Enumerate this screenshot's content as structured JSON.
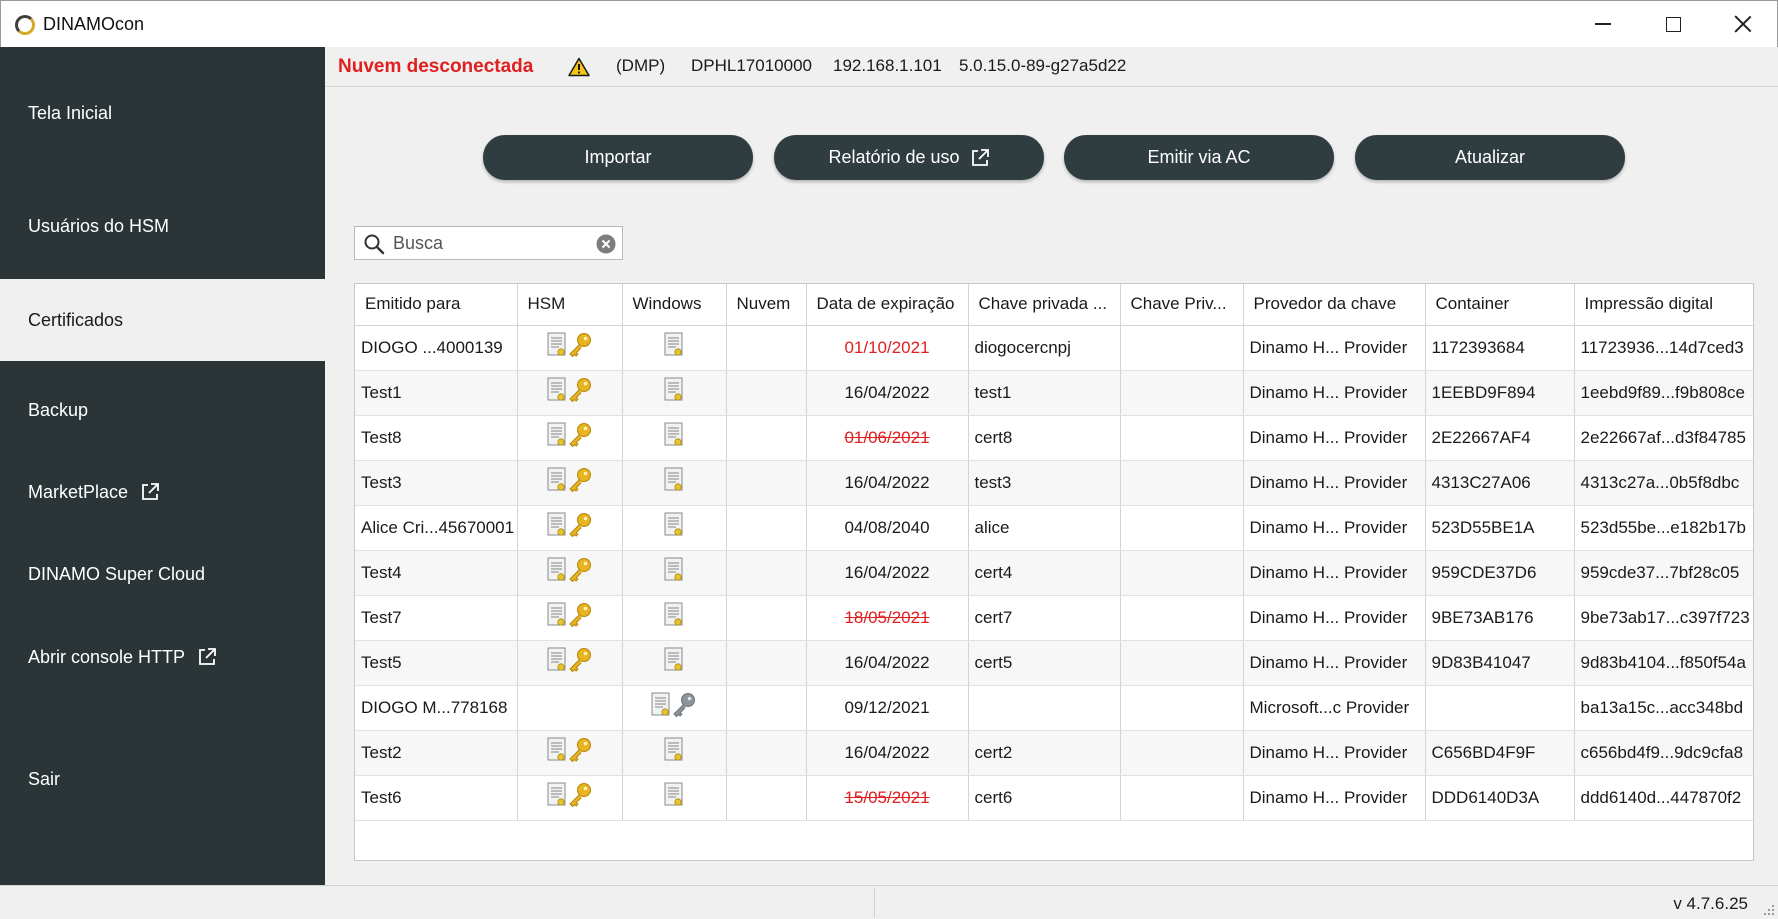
{
  "window": {
    "title": "DINAMOcon"
  },
  "sidebar": {
    "items": [
      {
        "label": "Tela Inicial",
        "external": false,
        "active": false
      },
      {
        "label": "Usuários do HSM",
        "external": false,
        "active": false
      },
      {
        "label": "Certificados",
        "external": false,
        "active": true
      },
      {
        "label": "Backup",
        "external": false,
        "active": false
      },
      {
        "label": "MarketPlace",
        "external": true,
        "active": false
      },
      {
        "label": "DINAMO Super Cloud",
        "external": false,
        "active": false
      },
      {
        "label": "Abrir console HTTP",
        "external": true,
        "active": false
      },
      {
        "label": "Sair",
        "external": false,
        "active": false
      }
    ]
  },
  "status": {
    "cloud": "Nuvem desconectada",
    "mode": "(DMP)",
    "serial": "DPHL17010000",
    "ip": "192.168.1.101",
    "firmware": "5.0.15.0-89-g27a5d22"
  },
  "toolbar": {
    "import_label": "Importar",
    "report_label": "Relatório de uso",
    "issue_label": "Emitir via AC",
    "refresh_label": "Atualizar"
  },
  "search": {
    "placeholder": "Busca",
    "value": ""
  },
  "table": {
    "columns": [
      "Emitido para",
      "HSM",
      "Windows",
      "Nuvem",
      "Data de expiração",
      "Chave privada ...",
      "Chave Priv...",
      "Provedor da chave",
      "Container",
      "Impressão digital"
    ],
    "rows": [
      {
        "issued_to": "DIOGO ...4000139",
        "hsm": true,
        "windows_cert": true,
        "windows_key": false,
        "date": "01/10/2021",
        "date_status": "warning",
        "key": "diogocercnpj",
        "provider": "Dinamo H... Provider",
        "container": "1172393684",
        "thumbprint": "11723936...14d7ced3"
      },
      {
        "issued_to": "Test1",
        "hsm": true,
        "windows_cert": true,
        "windows_key": false,
        "date": "16/04/2022",
        "date_status": "ok",
        "key": "test1",
        "provider": "Dinamo H... Provider",
        "container": "1EEBD9F894",
        "thumbprint": "1eebd9f89...f9b808ce"
      },
      {
        "issued_to": "Test8",
        "hsm": true,
        "windows_cert": true,
        "windows_key": false,
        "date": "01/06/2021",
        "date_status": "expired",
        "key": "cert8",
        "provider": "Dinamo H... Provider",
        "container": "2E22667AF4",
        "thumbprint": "2e22667af...d3f84785"
      },
      {
        "issued_to": "Test3",
        "hsm": true,
        "windows_cert": true,
        "windows_key": false,
        "date": "16/04/2022",
        "date_status": "ok",
        "key": "test3",
        "provider": "Dinamo H... Provider",
        "container": "4313C27A06",
        "thumbprint": "4313c27a...0b5f8dbc"
      },
      {
        "issued_to": "Alice Cri...45670001",
        "hsm": true,
        "windows_cert": true,
        "windows_key": false,
        "date": "04/08/2040",
        "date_status": "ok",
        "key": "alice",
        "provider": "Dinamo H... Provider",
        "container": "523D55BE1A",
        "thumbprint": "523d55be...e182b17b"
      },
      {
        "issued_to": "Test4",
        "hsm": true,
        "windows_cert": true,
        "windows_key": false,
        "date": "16/04/2022",
        "date_status": "ok",
        "key": "cert4",
        "provider": "Dinamo H... Provider",
        "container": "959CDE37D6",
        "thumbprint": "959cde37...7bf28c05"
      },
      {
        "issued_to": "Test7",
        "hsm": true,
        "windows_cert": true,
        "windows_key": false,
        "date": "18/05/2021",
        "date_status": "expired",
        "key": "cert7",
        "provider": "Dinamo H... Provider",
        "container": "9BE73AB176",
        "thumbprint": "9be73ab17...c397f723"
      },
      {
        "issued_to": "Test5",
        "hsm": true,
        "windows_cert": true,
        "windows_key": false,
        "date": "16/04/2022",
        "date_status": "ok",
        "key": "cert5",
        "provider": "Dinamo H... Provider",
        "container": "9D83B41047",
        "thumbprint": "9d83b4104...f850f54a"
      },
      {
        "issued_to": "DIOGO M...778168",
        "hsm": false,
        "windows_cert": true,
        "windows_key": true,
        "date": "09/12/2021",
        "date_status": "ok",
        "key": "",
        "provider": "Microsoft...c Provider",
        "container": "",
        "thumbprint": "ba13a15c...acc348bd"
      },
      {
        "issued_to": "Test2",
        "hsm": true,
        "windows_cert": true,
        "windows_key": false,
        "date": "16/04/2022",
        "date_status": "ok",
        "key": "cert2",
        "provider": "Dinamo H... Provider",
        "container": "C656BD4F9F",
        "thumbprint": "c656bd4f9...9dc9cfa8"
      },
      {
        "issued_to": "Test6",
        "hsm": true,
        "windows_cert": true,
        "windows_key": false,
        "date": "15/05/2021",
        "date_status": "expired",
        "key": "cert6",
        "provider": "Dinamo H... Provider",
        "container": "DDD6140D3A",
        "thumbprint": "ddd6140d...447870f2"
      }
    ]
  },
  "footer": {
    "version": "v 4.7.6.25"
  },
  "colors": {
    "sidebar_bg": "#2b3538",
    "button_bg": "#2f3c40",
    "alert_red": "#e02020",
    "key_gold": "#e8b41f",
    "key_gray": "#8c949a"
  },
  "icons": {
    "app": "dinamo-logo-icon",
    "warning": "warning-triangle-icon",
    "external": "external-link-icon",
    "search": "search-icon",
    "clear": "clear-circle-x-icon",
    "certificate": "certificate-document-icon",
    "key": "key-icon"
  }
}
